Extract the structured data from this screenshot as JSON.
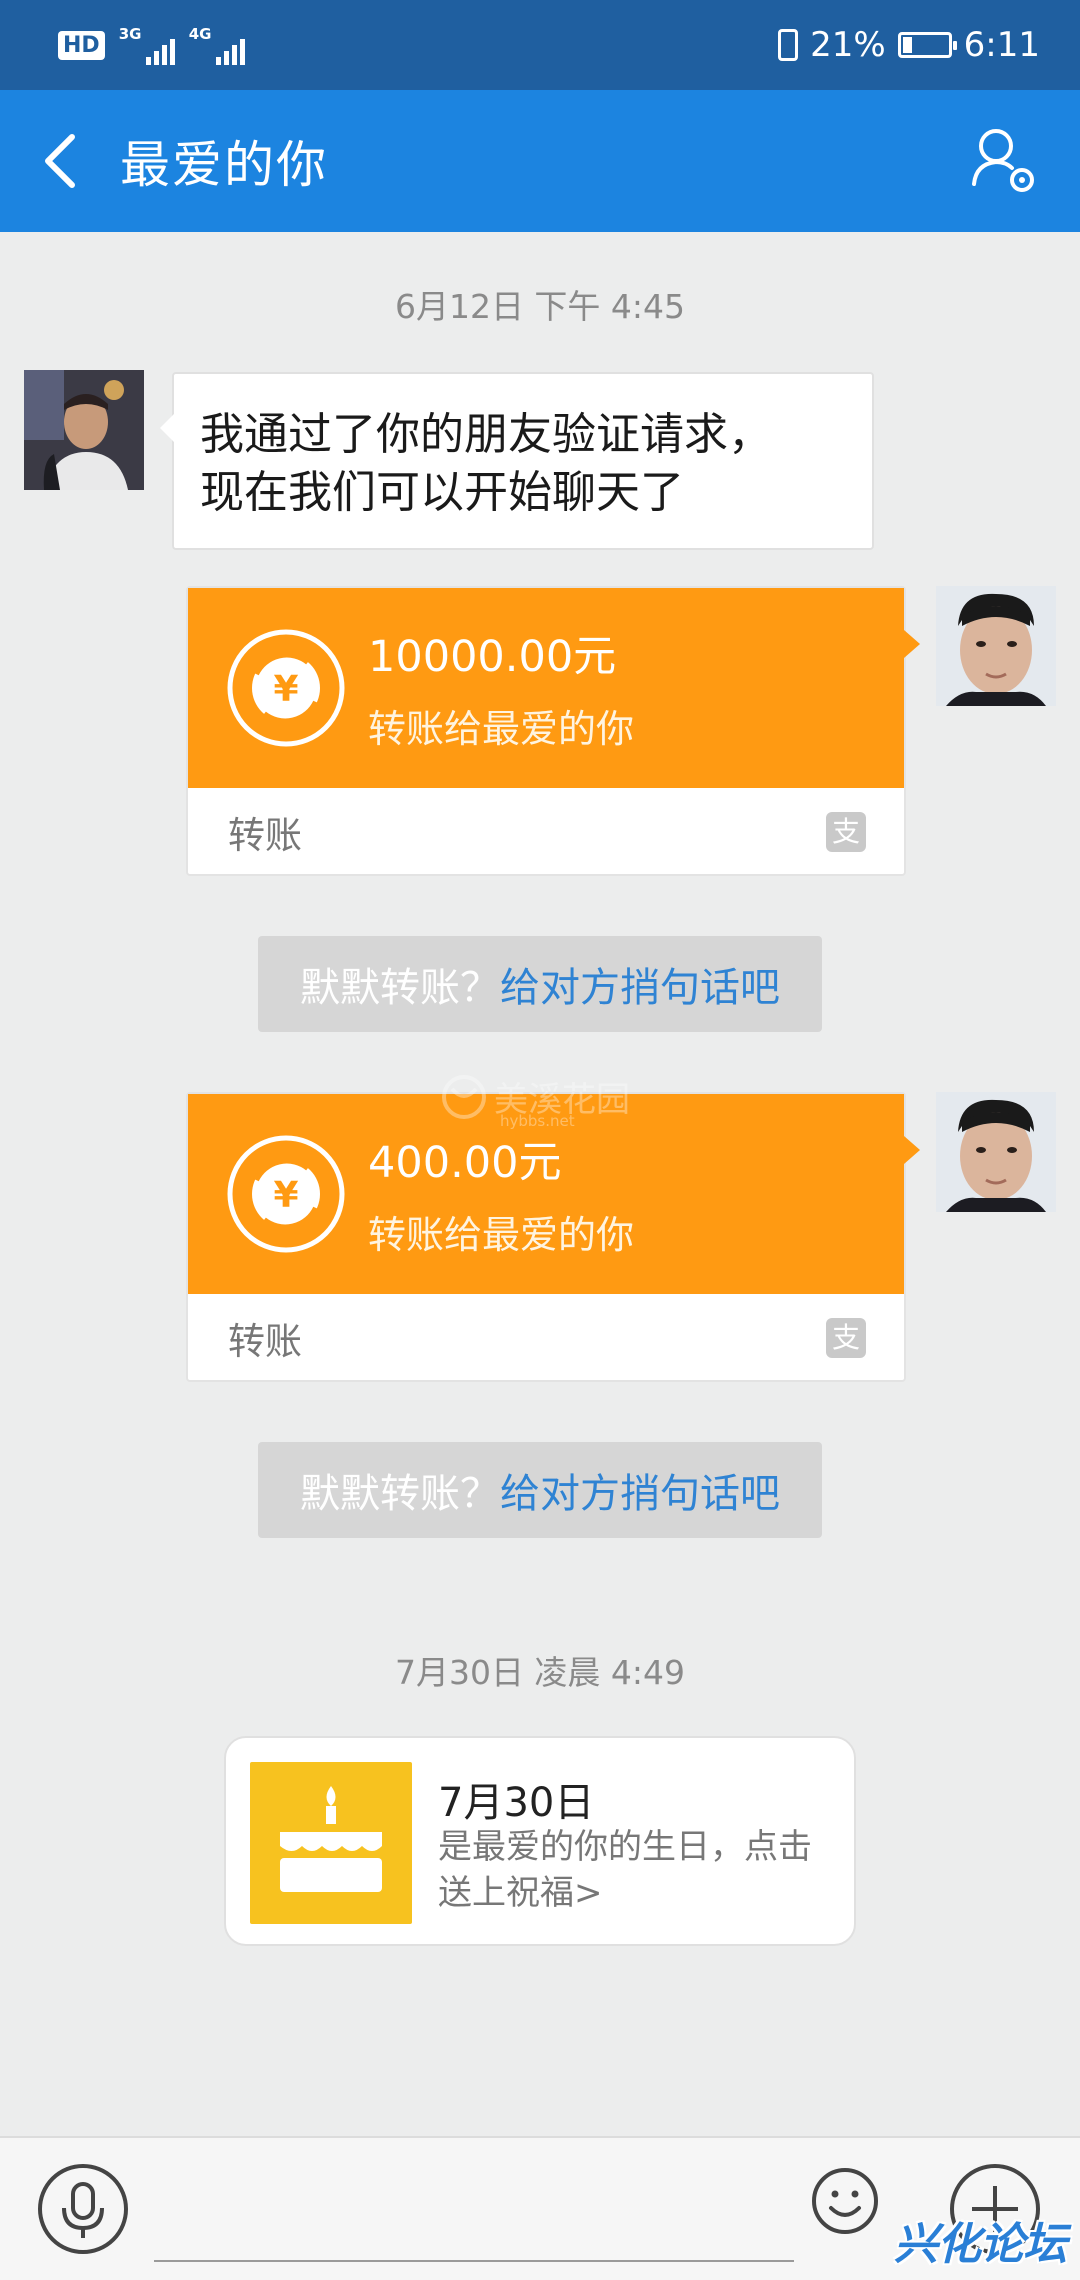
{
  "status_bar": {
    "hd": "HD",
    "sim1": "3G",
    "sim2": "4G",
    "battery": "21%",
    "battery_level": 0.21,
    "time": "6:11"
  },
  "header": {
    "title": "最爱的你",
    "back_icon": "chevron-left-icon",
    "profile_icon": "person-settings-icon"
  },
  "chat": {
    "timestamp1": "6月12日 下午 4:45",
    "system_message": [
      "我通过了你的朋友验证请求，",
      "现在我们可以开始聊天了"
    ],
    "transfers": [
      {
        "amount": "10000.00元",
        "to": "转账给最爱的你",
        "label": "转账",
        "badge": "支"
      },
      {
        "amount": "400.00元",
        "to": "转账给最爱的你",
        "label": "转账",
        "badge": "支"
      }
    ],
    "hint_question": "默默转账？",
    "hint_action": "给对方捎句话吧",
    "timestamp2": "7月30日 凌晨 4:49",
    "birthday": {
      "date": "7月30日",
      "text": "是最爱的你的生日，点击送上祝福>"
    }
  },
  "watermark": {
    "text": "美溪花园",
    "url": "hybbs.net"
  },
  "input_bar": {
    "placeholder": "",
    "logo": "兴化论坛"
  },
  "colors": {
    "status_bar": "#1f5fa0",
    "title_bar": "#1c84e0",
    "transfer_orange": "#ff9a12",
    "link_blue": "#2f83d3",
    "cake_yellow": "#f7c21f"
  }
}
